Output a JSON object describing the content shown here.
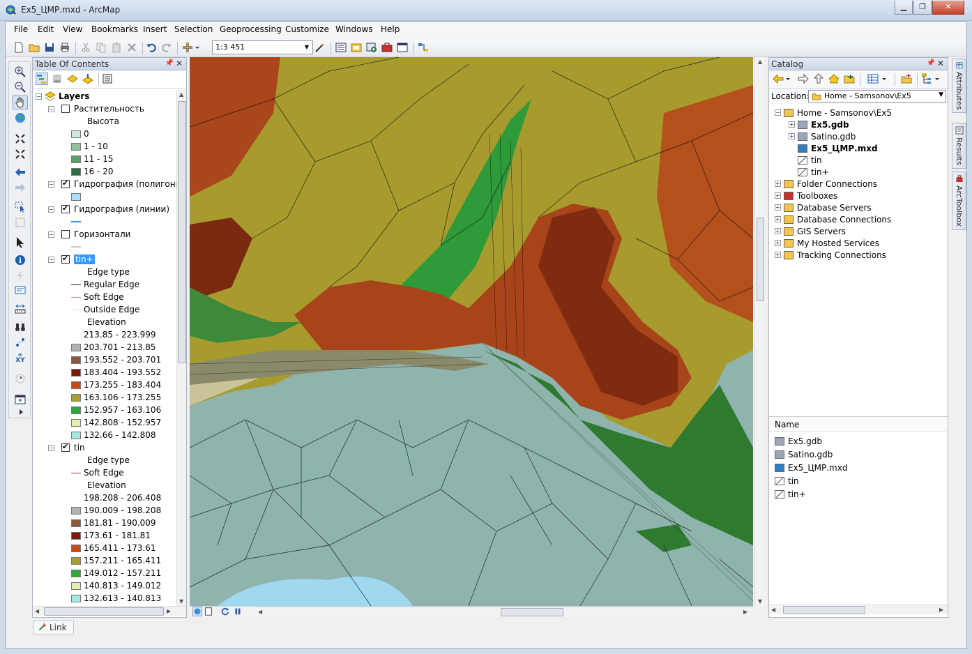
{
  "window": {
    "title": "Ex5_ЦМР.mxd - ArcMap",
    "minimize": "▁",
    "restore": "❐",
    "close": "✕"
  },
  "menu": [
    "File",
    "Edit",
    "View",
    "Bookmarks",
    "Insert",
    "Selection",
    "Geoprocessing",
    "Customize",
    "Windows",
    "Help"
  ],
  "toolbar": {
    "scale": "1:3 451"
  },
  "toc": {
    "title": "Table Of Contents",
    "root": "Layers",
    "layers": [
      {
        "name": "Растительность",
        "checked": false,
        "legend_title": "Высота",
        "classes": [
          {
            "label": "0",
            "color": "#cfe7d8"
          },
          {
            "label": "1 - 10",
            "color": "#8fc09a"
          },
          {
            "label": "11 - 15",
            "color": "#5c9e6e"
          },
          {
            "label": "16 - 20",
            "color": "#2f6e43"
          }
        ]
      },
      {
        "name": "Гидрография (полигоны)",
        "checked": true,
        "symbol_color": "#a8e0f5"
      },
      {
        "name": "Гидрография (линии)",
        "checked": true,
        "symbol_color": "#3a8fe0"
      },
      {
        "name": "Горизонтали",
        "checked": false,
        "symbol_color": "#c8c8c8"
      },
      {
        "name": "tin+",
        "checked": true,
        "selected": true,
        "edge_title": "Edge type",
        "edges": [
          {
            "label": "Regular Edge",
            "color": "#222222"
          },
          {
            "label": "Soft Edge",
            "color": "#e68a8a"
          },
          {
            "label": "Outside Edge",
            "color": "#bfe6ea"
          }
        ],
        "elev_title": "Elevation",
        "classes": [
          {
            "label": "213.85 - 223.999",
            "color": "#ffffff"
          },
          {
            "label": "203.701 - 213.85",
            "color": "#b3b3b3"
          },
          {
            "label": "193.552 - 203.701",
            "color": "#8a5a3c"
          },
          {
            "label": "183.404 - 193.552",
            "color": "#7a1a0a"
          },
          {
            "label": "173.255 - 183.404",
            "color": "#c84a14"
          },
          {
            "label": "163.106 - 173.255",
            "color": "#a8a030"
          },
          {
            "label": "152.957 - 163.106",
            "color": "#2ea83a"
          },
          {
            "label": "142.808 - 152.957",
            "color": "#e6efb0"
          },
          {
            "label": "132.66 - 142.808",
            "color": "#a6e6e3"
          }
        ]
      },
      {
        "name": "tin",
        "checked": true,
        "edge_title": "Edge type",
        "edges": [
          {
            "label": "Soft Edge",
            "color": "#c03030"
          }
        ],
        "elev_title": "Elevation",
        "classes": [
          {
            "label": "198.208 - 206.408",
            "color": "#ffffff"
          },
          {
            "label": "190.009 - 198.208",
            "color": "#b3b3b3"
          },
          {
            "label": "181.81 - 190.009",
            "color": "#8a5a3c"
          },
          {
            "label": "173.61 - 181.81",
            "color": "#7a1a0a"
          },
          {
            "label": "165.411 - 173.61",
            "color": "#c84a14"
          },
          {
            "label": "157.211 - 165.411",
            "color": "#a8a030"
          },
          {
            "label": "149.012 - 157.211",
            "color": "#2ea83a"
          },
          {
            "label": "140.813 - 149.012",
            "color": "#e6efb0"
          },
          {
            "label": "132.613 - 140.813",
            "color": "#a6e6e3"
          }
        ]
      }
    ]
  },
  "catalog": {
    "title": "Catalog",
    "location_label": "Location:",
    "location_value": "Home - Samsonov\\Ex5",
    "tree": [
      {
        "label": "Home - Samsonov\\Ex5",
        "icon": "home-folder-icon",
        "level": 0,
        "expander": "−",
        "bold": false
      },
      {
        "label": "Ex5.gdb",
        "icon": "geodatabase-icon",
        "level": 1,
        "expander": "+",
        "bold": true
      },
      {
        "label": "Satino.gdb",
        "icon": "geodatabase-icon",
        "level": 1,
        "expander": "+",
        "bold": false
      },
      {
        "label": "Ex5_ЦМР.mxd",
        "icon": "map-document-icon",
        "level": 1,
        "expander": "",
        "bold": true
      },
      {
        "label": "tin",
        "icon": "tin-icon",
        "level": 1,
        "expander": "",
        "bold": false
      },
      {
        "label": "tin+",
        "icon": "tin-icon",
        "level": 1,
        "expander": "",
        "bold": false
      },
      {
        "label": "Folder Connections",
        "icon": "folder-connections-icon",
        "level": 0,
        "expander": "+",
        "bold": false
      },
      {
        "label": "Toolboxes",
        "icon": "toolbox-icon",
        "level": 0,
        "expander": "+",
        "bold": false
      },
      {
        "label": "Database Servers",
        "icon": "database-server-icon",
        "level": 0,
        "expander": "+",
        "bold": false
      },
      {
        "label": "Database Connections",
        "icon": "database-connection-icon",
        "level": 0,
        "expander": "+",
        "bold": false
      },
      {
        "label": "GIS Servers",
        "icon": "gis-server-icon",
        "level": 0,
        "expander": "+",
        "bold": false
      },
      {
        "label": "My Hosted Services",
        "icon": "hosted-services-icon",
        "level": 0,
        "expander": "+",
        "bold": false
      },
      {
        "label": "Tracking Connections",
        "icon": "tracking-connection-icon",
        "level": 0,
        "expander": "+",
        "bold": false
      }
    ],
    "contents_header": "Name",
    "contents": [
      {
        "label": "Ex5.gdb",
        "icon": "geodatabase-icon"
      },
      {
        "label": "Satino.gdb",
        "icon": "geodatabase-icon"
      },
      {
        "label": "Ex5_ЦМР.mxd",
        "icon": "map-document-icon"
      },
      {
        "label": "tin",
        "icon": "tin-icon"
      },
      {
        "label": "tin+",
        "icon": "tin-icon"
      }
    ]
  },
  "side_tabs": [
    "Attributes",
    "Results",
    "ArcToolbox"
  ],
  "status": {
    "link_label": "Link"
  }
}
